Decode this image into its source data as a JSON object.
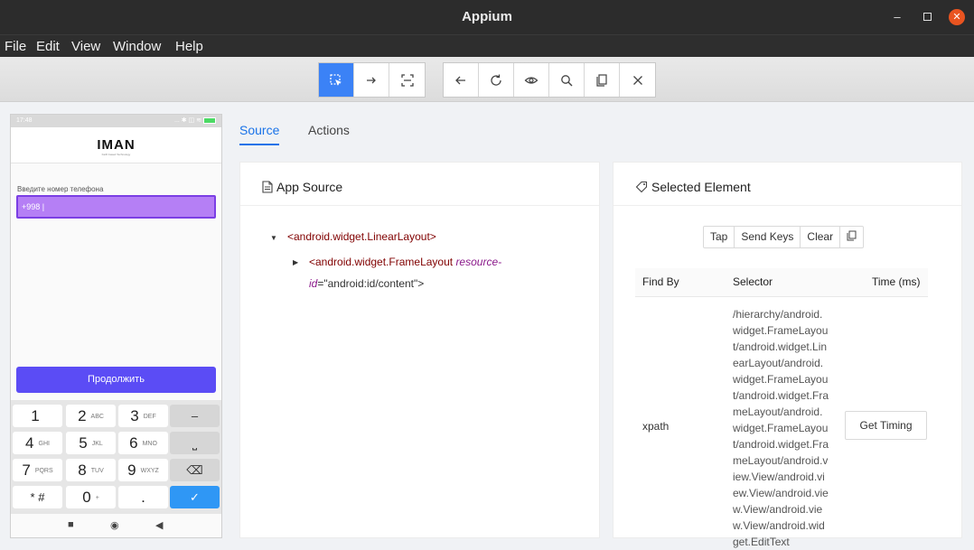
{
  "window": {
    "title": "Appium",
    "minimize": "–",
    "close": "✕"
  },
  "menu": [
    "File",
    "Edit",
    "View",
    "Window",
    "Help"
  ],
  "toolbar": {
    "group1": [
      "select-element-icon",
      "swipe-icon",
      "tap-by-coordinates-icon"
    ],
    "group2": [
      "back-icon",
      "refresh-icon",
      "show-hide-icon",
      "search-icon",
      "copy-xml-icon",
      "quit-session-icon"
    ]
  },
  "phone": {
    "time": "17:48",
    "status_icons": "... ✱ ◫ ≋",
    "logo": "IMAN",
    "logo_sub": "Faith based Technology",
    "label": "Введите номер телефона",
    "input_value": "+998 |",
    "continue": "Продолжить",
    "keys": [
      {
        "main": "1",
        "sub": ""
      },
      {
        "main": "2",
        "sub": "ABC"
      },
      {
        "main": "3",
        "sub": "DEF"
      },
      {
        "main": "–",
        "sub": ""
      },
      {
        "main": "4",
        "sub": "GHI"
      },
      {
        "main": "5",
        "sub": "JKL"
      },
      {
        "main": "6",
        "sub": "MNO"
      },
      {
        "main": "⎵",
        "sub": ""
      },
      {
        "main": "7",
        "sub": "PQRS"
      },
      {
        "main": "8",
        "sub": "TUV"
      },
      {
        "main": "9",
        "sub": "WXYZ"
      },
      {
        "main": "⌫",
        "sub": ""
      },
      {
        "main": "* #",
        "sub": ""
      },
      {
        "main": "0",
        "sub": "+"
      },
      {
        "main": ".",
        "sub": ""
      },
      {
        "main": "✓",
        "sub": ""
      }
    ],
    "nav": [
      "■",
      "◉",
      "◀"
    ]
  },
  "tabs": {
    "source": "Source",
    "actions": "Actions"
  },
  "source_panel": {
    "title": "App Source",
    "node1": "<android.widget.LinearLayout>",
    "node2_tag": "<android.widget.FrameLayout",
    "node2_attr_a": "resource-",
    "node2_attr_b": "id",
    "node2_value": "=\"android:id/content\">"
  },
  "element_panel": {
    "title": "Selected Element",
    "actions": [
      "Tap",
      "Send Keys",
      "Clear"
    ],
    "columns": [
      "Find By",
      "Selector",
      "Time (ms)"
    ],
    "find_by": "xpath",
    "selector_lines": [
      "/hierarchy/android.",
      "widget.FrameLayou",
      "t/android.widget.Lin",
      "earLayout/android.",
      "widget.FrameLayou",
      "t/android.widget.Fra",
      "meLayout/android.",
      "widget.FrameLayou",
      "t/android.widget.Fra",
      "meLayout/android.v",
      "iew.View/android.vi",
      "ew.View/android.vie",
      "w.View/android.vie",
      "w.View/android.wid",
      "get.EditText"
    ],
    "timing_button": "Get Timing"
  }
}
